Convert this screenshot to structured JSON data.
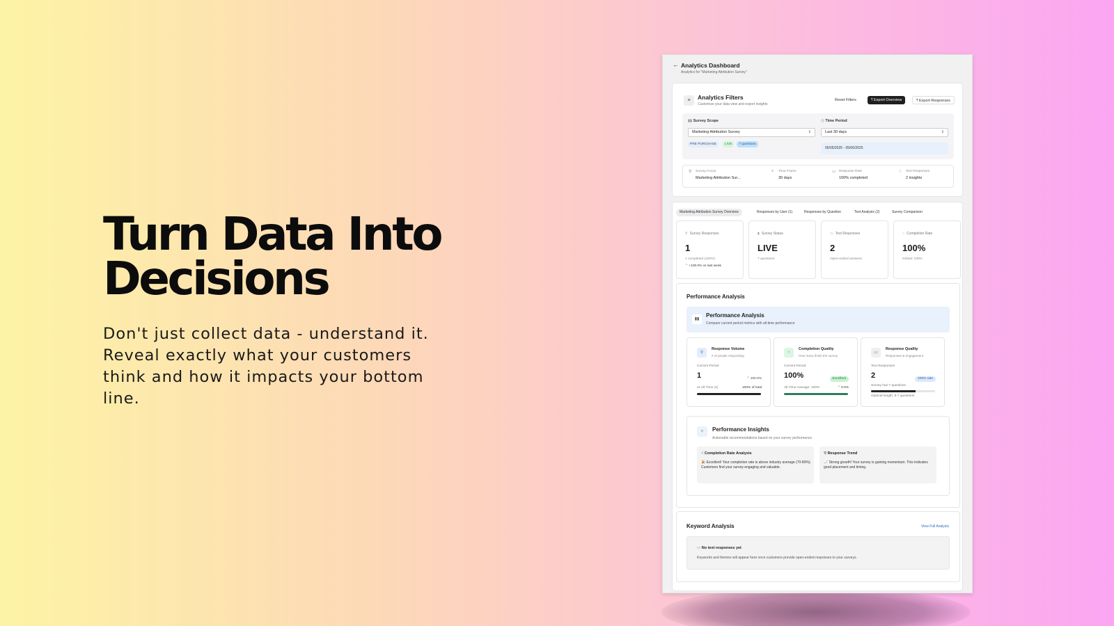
{
  "hero": {
    "title_line1": "Turn Data Into",
    "title_line2": "Decisions",
    "subtitle": "Don't just collect data - understand it. Reveal exactly what your customers think and how it impacts your bottom line."
  },
  "dashboard": {
    "title": "Analytics Dashboard",
    "subtitle": "Analytics for \"Marketing Attribution Survey\"",
    "filters": {
      "title": "Analytics Filters",
      "subtitle": "Customize your data view and export insights",
      "reset_label": "Reset Filters",
      "export_overview_label": "Export Overview",
      "export_responses_label": "Export Responses",
      "scope_label": "Survey Scope",
      "scope_value": "Marketing Attribution Survey",
      "tags": [
        "PRE PURCHASE",
        "LIVE",
        "7 questions"
      ],
      "period_label": "Time Period",
      "period_value": "Last 30 days",
      "date_range": "05/05/2025 - 05/06/2025",
      "summary": [
        {
          "key": "Survey Focus",
          "value": "Marketing Attribution Sur..."
        },
        {
          "key": "Time Frame",
          "value": "30 days"
        },
        {
          "key": "Response Rate",
          "value": "100% completed"
        },
        {
          "key": "Text Responses",
          "value": "2 insights"
        }
      ]
    },
    "tabs": [
      "Marketing Attribution Survey Overview",
      "Responses by User (1)",
      "Responses by Question",
      "Text Analysis (2)",
      "Survey Comparison"
    ],
    "stats": [
      {
        "label": "Survey Responses",
        "value": "1",
        "note": "1 completed (100%)",
        "trend": "+100.0% vs last week"
      },
      {
        "label": "Survey Status",
        "value": "LIVE",
        "note": "7 questions",
        "trend": ""
      },
      {
        "label": "Text Responses",
        "value": "2",
        "note": "Open-ended answers",
        "trend": ""
      },
      {
        "label": "Completion Rate",
        "value": "100%",
        "note": "Global: 100%",
        "trend": ""
      }
    ],
    "performance": {
      "heading": "Performance Analysis",
      "banner_title": "Performance Analysis",
      "banner_sub": "Compare current period metrics with all-time performance",
      "cards": [
        {
          "title": "Response Volume",
          "sub": "# of people responding",
          "period_label": "Current Period",
          "value": "1",
          "right": "100.0%",
          "bottom_left": "vs All-Time (1)",
          "bottom_right": "100% of total",
          "fill": 1.0
        },
        {
          "title": "Completion Quality",
          "sub": "How many finish the survey",
          "period_label": "Current Period",
          "value": "100%",
          "pill": "Excellent",
          "bottom_left": "All-Time Average: 100%",
          "bottom_right": "0.0%",
          "fill": 1.0
        },
        {
          "title": "Response Quality",
          "sub": "Responses & engagement",
          "period_label": "Text Responses",
          "value": "2",
          "pill": "200% rate",
          "bottom_left": "Survey has 7 questions",
          "bottom_right": "",
          "extra": "Optimal length: 5-7 questions",
          "fill": 0.7
        }
      ],
      "insights": {
        "title": "Performance Insights",
        "subtitle": "Actionable recommendations based on your survey performance",
        "items": [
          {
            "title": "Completion Rate Analysis",
            "body": "🎉 Excellent! Your completion rate is above industry average (70-80%). Customers find your survey engaging and valuable."
          },
          {
            "title": "Response Trend",
            "body": "📈 Strong growth! Your survey is gaining momentum. This indicates good placement and timing."
          }
        ]
      }
    },
    "keywords": {
      "title": "Keyword Analysis",
      "link": "View Full Analysis",
      "empty_title": "No text responses yet",
      "empty_sub": "Keywords and themes will appear here once customers provide open-ended responses to your surveys."
    }
  },
  "colors": {
    "live_tag": "#d7f5dc",
    "questions_tag": "#bfe0fb",
    "scope_tag": "#e5edf8",
    "excellent_pill": "#c9f1d3",
    "rate_pill": "#dbe9fb",
    "link": "#2b6cc4"
  }
}
